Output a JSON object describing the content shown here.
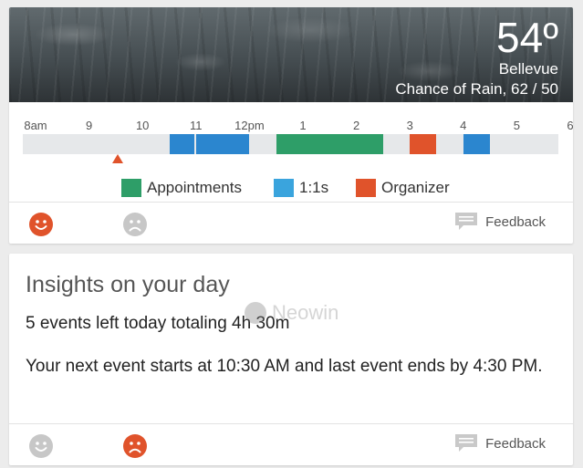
{
  "weather": {
    "temperature": "54º",
    "city": "Bellevue",
    "forecast": "Chance of Rain, 62 / 50"
  },
  "timeline": {
    "hours": [
      "8am",
      "9",
      "10",
      "11",
      "12pm",
      "1",
      "2",
      "3",
      "4",
      "5",
      "6"
    ],
    "start_hour": 7.95,
    "end_hour": 18.1,
    "current_time_hour": 9.7,
    "events": [
      {
        "type": "1:1s",
        "start": 10.5,
        "end": 11.0
      },
      {
        "type": "1:1s",
        "start": 11.0,
        "end": 12.0
      },
      {
        "type": "Appointments",
        "start": 12.5,
        "end": 14.5
      },
      {
        "type": "Organizer",
        "start": 15.0,
        "end": 15.5
      },
      {
        "type": "1:1s",
        "start": 16.0,
        "end": 16.5
      }
    ]
  },
  "legend": [
    {
      "label": "Appointments",
      "color": "#2e9e68"
    },
    {
      "label": "1:1s",
      "color": "#3aa4dd"
    },
    {
      "label": "Organizer",
      "color": "#e0532b"
    }
  ],
  "colors": {
    "Appointments": "#2e9e68",
    "1:1s": "#2b86cf",
    "Organizer": "#e0532b",
    "active_face": "#e0532b",
    "inactive_face": "#c7c7c7"
  },
  "card1_footer": {
    "happy_state": "active",
    "sad_state": "inactive",
    "feedback_label": "Feedback"
  },
  "insights": {
    "title": "Insights on your day",
    "line1": "5 events left today totaling 4h 30m",
    "line2": "Your next event starts at 10:30 AM and last event ends by 4:30 PM."
  },
  "card2_footer": {
    "happy_state": "inactive",
    "sad_state": "active",
    "feedback_label": "Feedback"
  },
  "watermark": {
    "text": "Neowin"
  }
}
